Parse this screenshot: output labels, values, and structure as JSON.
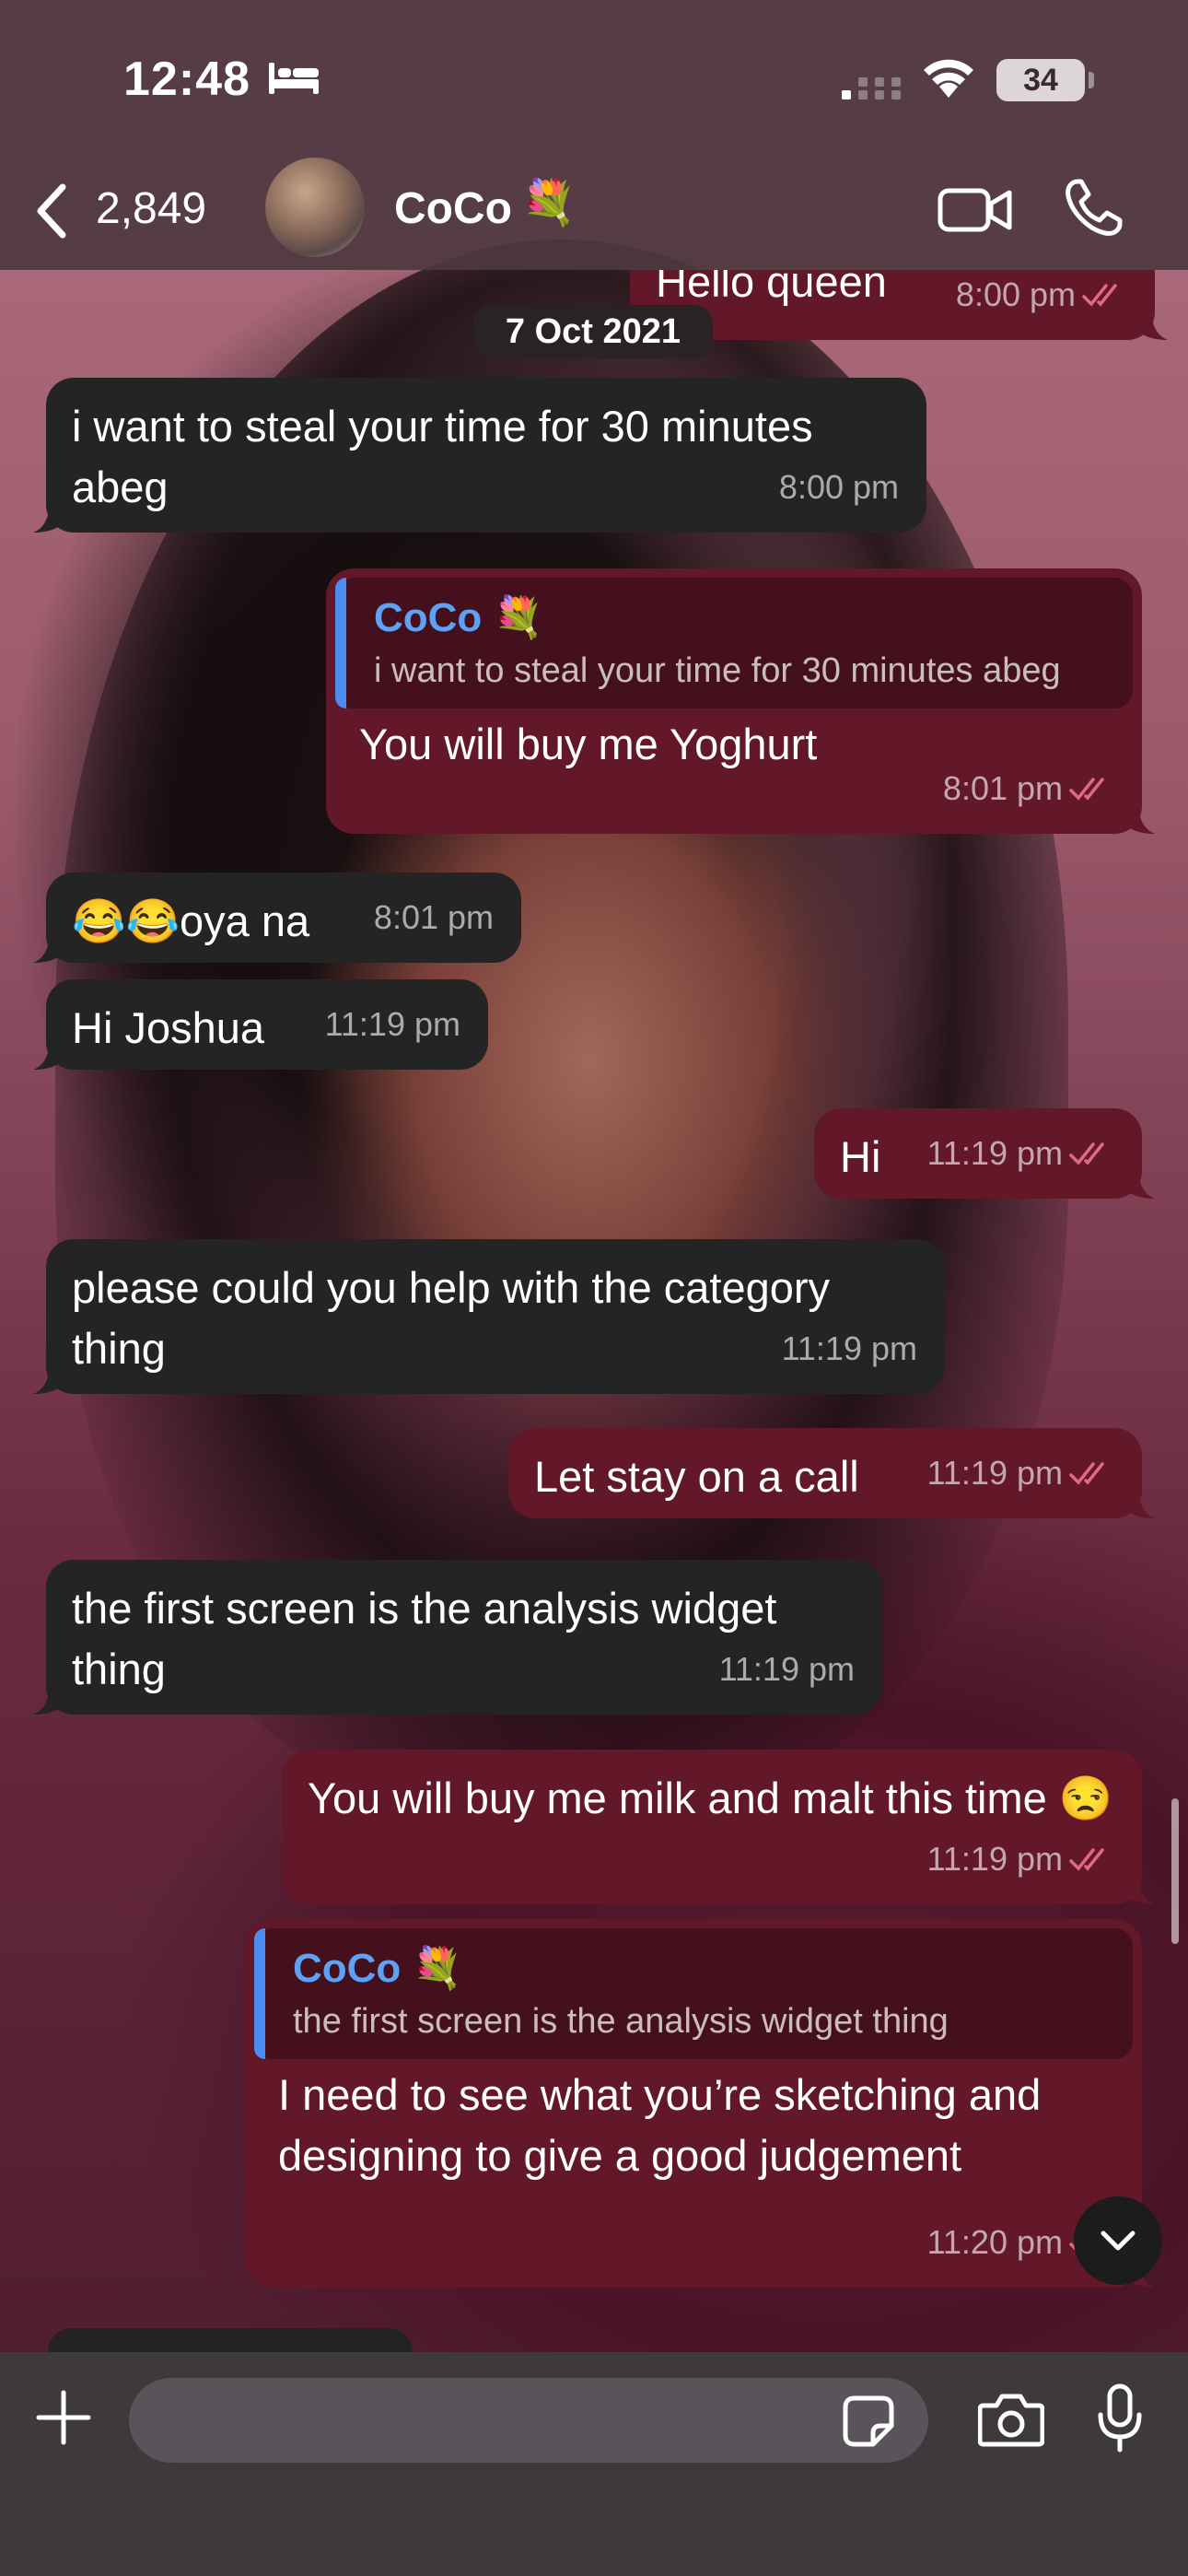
{
  "status_bar": {
    "time": "12:48",
    "battery": "34"
  },
  "header": {
    "back_count": "2,849",
    "contact_name": "CoCo",
    "contact_emoji": "💐"
  },
  "chat": {
    "date_separator": "7 Oct 2021",
    "messages": [
      {
        "direction": "out",
        "text": "Hello queen",
        "time": "8:00 pm"
      },
      {
        "direction": "in",
        "text": "i want to steal your time for 30 minutes abeg",
        "time": "8:00 pm"
      },
      {
        "direction": "out",
        "quote_name": "CoCo 💐",
        "quote_text": "i want to steal your time for 30 minutes abeg",
        "text": "You will buy me Yoghurt",
        "time": "8:01 pm"
      },
      {
        "direction": "in",
        "text": "😂😂oya na",
        "time": "8:01 pm"
      },
      {
        "direction": "in",
        "text": "Hi Joshua",
        "time": "11:19 pm"
      },
      {
        "direction": "out",
        "text": "Hi",
        "time": "11:19 pm"
      },
      {
        "direction": "in",
        "text": "please could you help with the category thing",
        "time": "11:19 pm"
      },
      {
        "direction": "out",
        "text": "Let stay on a call",
        "time": "11:19 pm"
      },
      {
        "direction": "in",
        "text": "the first screen is the analysis widget thing",
        "time": "11:19 pm"
      },
      {
        "direction": "out",
        "text": "You will buy me milk and malt this time 😒",
        "time": "11:19 pm"
      },
      {
        "direction": "out",
        "quote_name": "CoCo 💐",
        "quote_text": "the first screen is the analysis widget thing",
        "text": "I need to see what you’re sketching and designing to give a good judgement",
        "time": "11:20 pm"
      }
    ]
  },
  "input": {
    "placeholder": ""
  },
  "colors": {
    "incoming": "#242424",
    "outgoing": "#621828",
    "quote_accent": "#4a8cf0",
    "quote_name": "#5da2f5"
  }
}
